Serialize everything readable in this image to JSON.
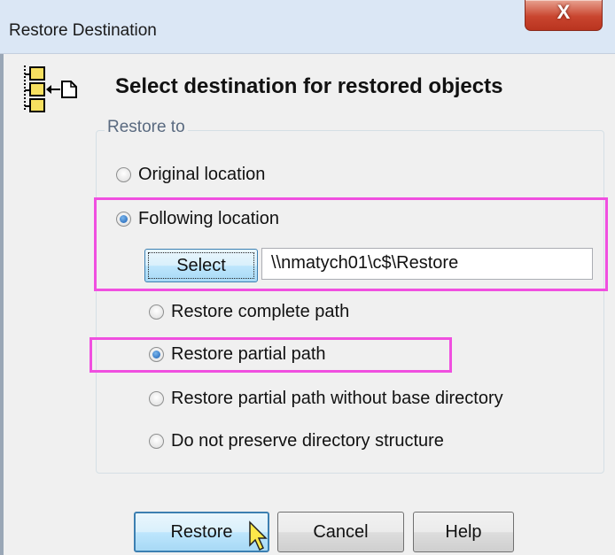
{
  "window": {
    "title": "Restore Destination",
    "close_glyph": "X"
  },
  "header": {
    "icon": "tree-restore-icon",
    "heading": "Select destination for restored objects"
  },
  "restore_to": {
    "legend": "Restore to",
    "options": [
      {
        "label": "Original location",
        "selected": false
      },
      {
        "label": "Following location",
        "selected": true
      }
    ],
    "select_button": "Select",
    "path_value": "\\\\nmatych01\\c$\\Restore",
    "path_options": [
      {
        "label": "Restore complete path",
        "selected": false
      },
      {
        "label": "Restore partial path",
        "selected": true
      },
      {
        "label": "Restore partial path without base directory",
        "selected": false
      },
      {
        "label": "Do not preserve directory structure",
        "selected": false
      }
    ]
  },
  "footer": {
    "restore_button": "Restore",
    "cancel_button": "Cancel",
    "help_button": "Help"
  },
  "colors": {
    "highlight": "#f04fe0",
    "accent": "#3c7fb1"
  }
}
